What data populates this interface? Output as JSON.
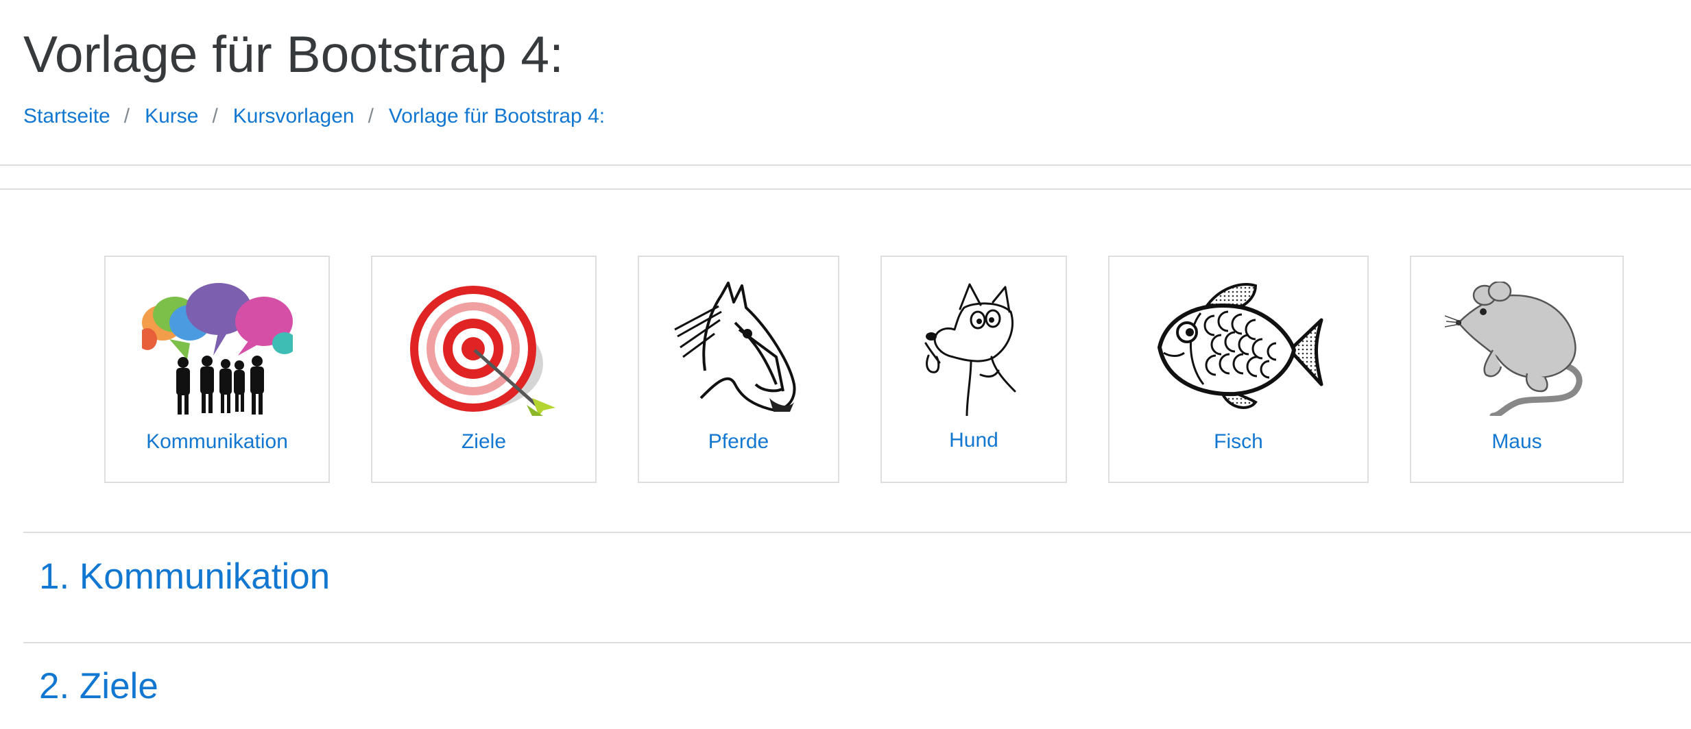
{
  "page": {
    "title": "Vorlage für Bootstrap 4:"
  },
  "breadcrumb": {
    "separator": "/",
    "items": [
      "Startseite",
      "Kurse",
      "Kursvorlagen",
      "Vorlage für Bootstrap 4:"
    ]
  },
  "tiles": [
    {
      "label": "Kommunikation",
      "icon": "communication-people-icon"
    },
    {
      "label": "Ziele",
      "icon": "target-icon"
    },
    {
      "label": "Pferde",
      "icon": "horse-icon"
    },
    {
      "label": "Hund",
      "icon": "dog-icon"
    },
    {
      "label": "Fisch",
      "icon": "fish-icon"
    },
    {
      "label": "Maus",
      "icon": "mouse-icon"
    }
  ],
  "sections": [
    {
      "title": "1. Kommunikation"
    },
    {
      "title": "2. Ziele"
    }
  ],
  "colors": {
    "link": "#1177d1",
    "heading": "#373a3c",
    "border": "#dedede",
    "target_red": "#e02424"
  }
}
